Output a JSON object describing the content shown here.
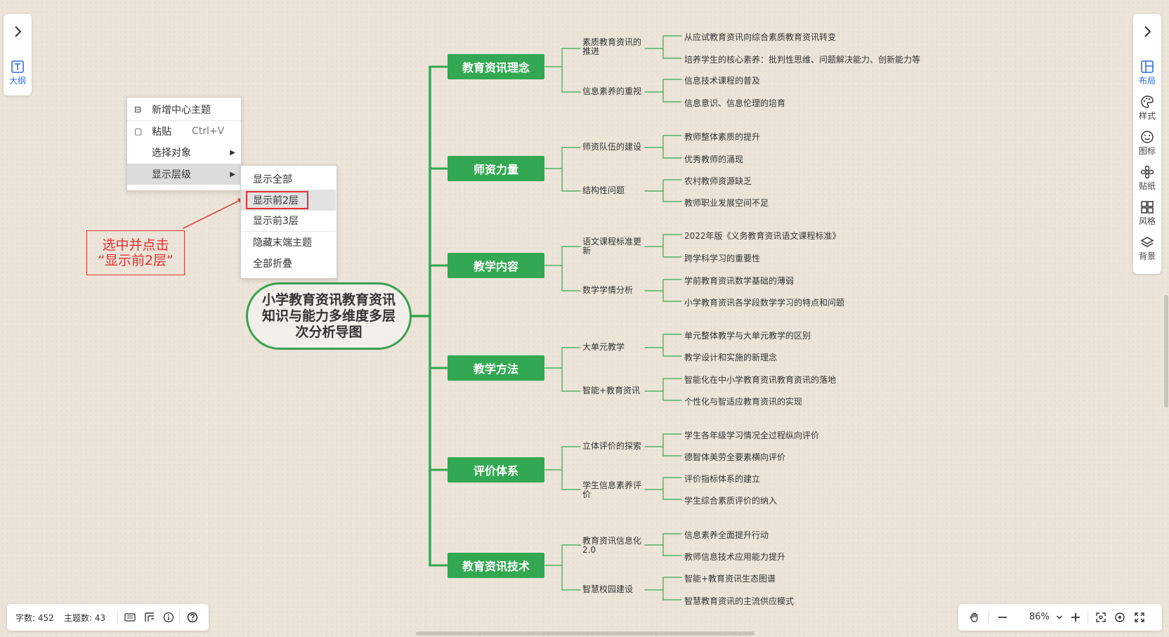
{
  "left_panel": {
    "outline_label": "大纲"
  },
  "right_panel": {
    "tools": [
      {
        "name": "layout",
        "label": "布局",
        "icon": "layout-icon"
      },
      {
        "name": "style",
        "label": "样式",
        "icon": "palette-icon"
      },
      {
        "name": "icon",
        "label": "图标",
        "icon": "smile-icon"
      },
      {
        "name": "sticker",
        "label": "贴纸",
        "icon": "flower-icon"
      },
      {
        "name": "theme",
        "label": "风格",
        "icon": "grid-icon"
      },
      {
        "name": "background",
        "label": "背景",
        "icon": "layers-icon"
      }
    ]
  },
  "context_menu": {
    "items": [
      {
        "label": "新增中心主题",
        "shortcut": "",
        "icon": "center-topic-icon"
      },
      {
        "label": "粘贴",
        "shortcut": "Ctrl+V",
        "icon": "paste-icon"
      },
      {
        "label": "选择对象",
        "shortcut": ""
      },
      {
        "label": "显示层级",
        "shortcut": ""
      }
    ],
    "submenu": [
      "显示全部",
      "显示前2层",
      "显示前3层",
      "隐藏末端主题",
      "全部折叠"
    ]
  },
  "annotation": {
    "line1": "选中并点击",
    "line2": "“显示前2层”"
  },
  "mindmap": {
    "center": "小学教育资讯教育资讯知识与能力多维度多层次分析导图",
    "branches": [
      {
        "title": "教育资讯理念",
        "children": [
          {
            "title": "素质教育资讯的推进",
            "leaves": [
              "从应试教育资讯向综合素质教育资讯转变",
              "培养学生的核心素养：批判性思维、问题解决能力、创新能力等"
            ]
          },
          {
            "title": "信息素养的重视",
            "leaves": [
              "信息技术课程的普及",
              "信息意识、信息伦理的培育"
            ]
          }
        ]
      },
      {
        "title": "师资力量",
        "children": [
          {
            "title": "师资队伍的建设",
            "leaves": [
              "教师整体素质的提升",
              "优秀教师的涌现"
            ]
          },
          {
            "title": "结构性问题",
            "leaves": [
              "农村教师资源缺乏",
              "教师职业发展空间不足"
            ]
          }
        ]
      },
      {
        "title": "教学内容",
        "children": [
          {
            "title": "语文课程标准更新",
            "leaves": [
              "2022年版《义务教育资讯语文课程标准》",
              "跨学科学习的重要性"
            ]
          },
          {
            "title": "数学学情分析",
            "leaves": [
              "学前教育资讯数学基础的薄弱",
              "小学教育资讯各学段数学学习的特点和问题"
            ]
          }
        ]
      },
      {
        "title": "教学方法",
        "children": [
          {
            "title": "大单元教学",
            "leaves": [
              "单元整体教学与大单元教学的区别",
              "教学设计和实施的新理念"
            ]
          },
          {
            "title": "智能+教育资讯",
            "leaves": [
              "智能化在中小学教育资讯教育资讯的落地",
              "个性化与智适应教育资讯的实现"
            ]
          }
        ]
      },
      {
        "title": "评价体系",
        "children": [
          {
            "title": "立体评价的探索",
            "leaves": [
              "学生各年级学习情况全过程纵向评价",
              "德智体美劳全要素横向评价"
            ]
          },
          {
            "title": "学生信息素养评价",
            "leaves": [
              "评价指标体系的建立",
              "学生综合素质评价的纳入"
            ]
          }
        ]
      },
      {
        "title": "教育资讯技术",
        "children": [
          {
            "title": "教育资讯信息化2.0",
            "leaves": [
              "信息素养全面提升行动",
              "教师信息技术应用能力提升"
            ]
          },
          {
            "title": "智慧校园建设",
            "leaves": [
              "智能+教育资讯生态图谱",
              "智慧教育资讯的主流供应模式"
            ]
          }
        ]
      }
    ]
  },
  "status_bar": {
    "word_count": "字数: 452",
    "topic_count": "主题数: 43"
  },
  "zoom": {
    "level": "86%"
  }
}
